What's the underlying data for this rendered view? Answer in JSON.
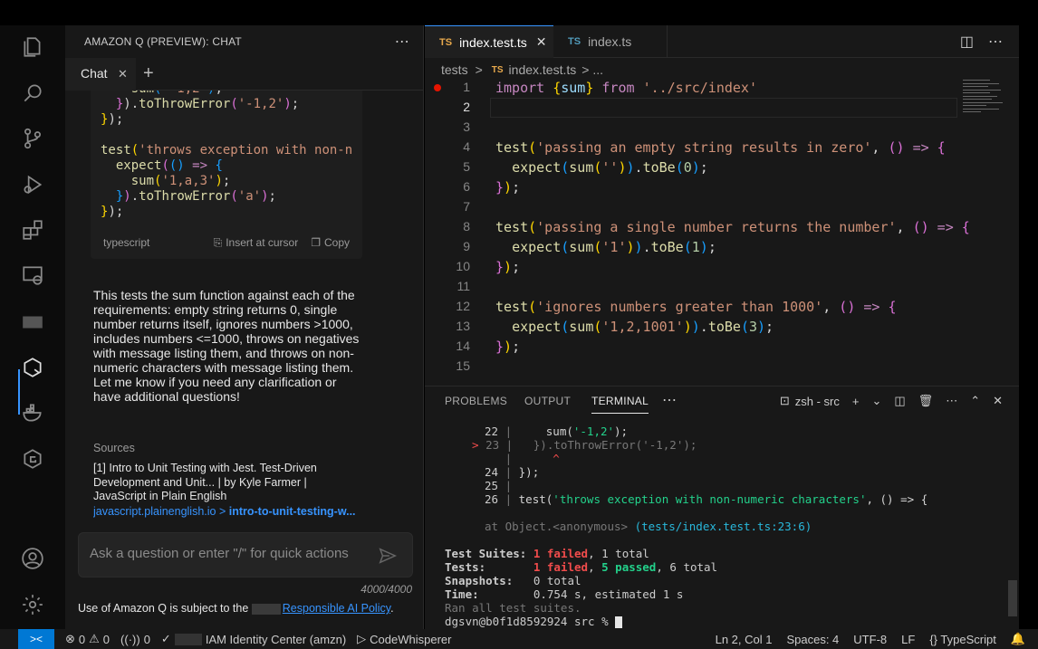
{
  "chat": {
    "header_title": "AMAZON Q (PREVIEW): CHAT",
    "tab_label": "Chat",
    "code_language": "typescript",
    "insert_label": "Insert at cursor",
    "copy_label": "Copy",
    "message": "This tests the sum function against each of the requirements: empty string returns 0, single number returns itself, ignores numbers >1000, includes numbers <=1000, throws on negatives with message listing them, and throws on non-numeric characters with message listing them. Let me know if you need any clarification or have additional questions!",
    "sources_title": "Sources",
    "source_text": "[1] Intro to Unit Testing with Jest. Test-Driven Development and Unit... | by Kyle Farmer | JavaScript in Plain English",
    "source_domain": "javascript.plainenglish.io",
    "source_sep": " > ",
    "source_path": "intro-to-unit-testing-w...",
    "input_placeholder": "Ask a question or enter \"/\" for quick actions",
    "char_count": "4000/4000",
    "policy_prefix": "Use of Amazon Q is subject to the",
    "policy_link": "Responsible AI Policy",
    "policy_suffix": "."
  },
  "editor": {
    "tabs": [
      {
        "badge": "TS",
        "label": "index.test.ts",
        "close": "✕"
      },
      {
        "badge": "TS",
        "label": "index.ts"
      }
    ],
    "breadcrumb": {
      "folder": "tests",
      "sep": ">",
      "badge": "TS",
      "file": "index.test.ts",
      "tail": "> ..."
    },
    "line_numbers": [
      "1",
      "2",
      "3",
      "4",
      "5",
      "6",
      "7",
      "8",
      "9",
      "10",
      "11",
      "12",
      "13",
      "14",
      "15"
    ]
  },
  "panel": {
    "tabs": [
      "PROBLEMS",
      "OUTPUT",
      "TERMINAL"
    ],
    "shell_label": "zsh - src",
    "terminal": {
      "n22": "22",
      "n23": "23",
      "n24": "24",
      "n25": "25",
      "n26": "26",
      "marker": ">",
      "bar": "|",
      "caret": "^",
      "trace": "at Object.<anonymous>",
      "trace_loc": "(tests/index.test.ts:23:6)",
      "suites_label": "Test Suites:",
      "suites_failed": "1 failed",
      "suites_rest": ", 1 total",
      "tests_label": "Tests:",
      "tests_failed": "1 failed",
      "tests_sep": ", ",
      "tests_passed": "5 passed",
      "tests_rest": ", 6 total",
      "snap_label": "Snapshots:",
      "snap_val": "0 total",
      "time_label": "Time:",
      "time_val": "0.754 s, estimated 1 s",
      "ran": "Ran all test suites.",
      "prompt": "dgsvn@b0f1d8592924 src % "
    }
  },
  "status": {
    "errors": "0",
    "warnings": "0",
    "ports": "0",
    "identity": "IAM Identity Center (amzn)",
    "codewhisperer": "CodeWhisperer",
    "position": "Ln 2, Col 1",
    "spaces": "Spaces: 4",
    "encoding": "UTF-8",
    "eol": "LF",
    "language": "TypeScript",
    "language_braces": "{}"
  },
  "colors": {
    "accent": "#3794ff",
    "remote": "#0078d4",
    "error": "#f14c4c",
    "pass": "#23d18b"
  }
}
